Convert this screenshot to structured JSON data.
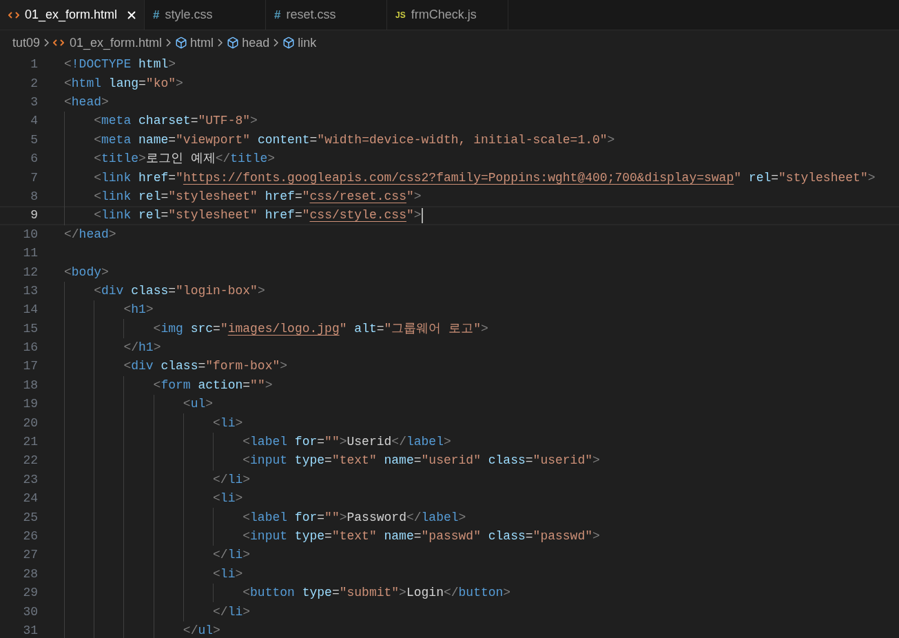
{
  "tabs": [
    {
      "label": "01_ex_form.html",
      "kind": "html",
      "selected": true
    },
    {
      "label": "style.css",
      "kind": "css",
      "glyph": "#",
      "selected": false
    },
    {
      "label": "reset.css",
      "kind": "css",
      "glyph": "#",
      "selected": false
    },
    {
      "label": "frmCheck.js",
      "kind": "js",
      "glyph": "JS",
      "selected": false
    }
  ],
  "breadcrumbs": [
    {
      "label": "tut09",
      "kind": "folder"
    },
    {
      "label": "01_ex_form.html",
      "kind": "file"
    },
    {
      "label": "html",
      "kind": "element"
    },
    {
      "label": "head",
      "kind": "element"
    },
    {
      "label": "link",
      "kind": "element"
    }
  ],
  "lines": [
    {
      "number": "1",
      "current": false,
      "tokens": [
        {
          "kind": "punct",
          "text": "<"
        },
        {
          "kind": "tag",
          "text": "!DOCTYPE"
        },
        {
          "kind": "attr",
          "text": " html"
        },
        {
          "kind": "punct",
          "text": ">"
        }
      ]
    },
    {
      "number": "2",
      "current": false,
      "tokens": [
        {
          "kind": "punct",
          "text": "<"
        },
        {
          "kind": "tag",
          "text": "html"
        },
        {
          "kind": "attr",
          "text": " lang"
        },
        {
          "kind": "op",
          "text": "="
        },
        {
          "kind": "string",
          "text": "\"ko\""
        },
        {
          "kind": "punct",
          "text": ">"
        }
      ]
    },
    {
      "number": "3",
      "current": false,
      "tokens": [
        {
          "kind": "punct",
          "text": "<"
        },
        {
          "kind": "tag",
          "text": "head"
        },
        {
          "kind": "punct",
          "text": ">"
        }
      ]
    },
    {
      "number": "4",
      "current": false,
      "tokens": [
        {
          "kind": "punct",
          "text": "    <"
        },
        {
          "kind": "tag",
          "text": "meta"
        },
        {
          "kind": "attr",
          "text": " charset"
        },
        {
          "kind": "op",
          "text": "="
        },
        {
          "kind": "string",
          "text": "\"UTF-8\""
        },
        {
          "kind": "punct",
          "text": ">"
        }
      ]
    },
    {
      "number": "5",
      "current": false,
      "tokens": [
        {
          "kind": "punct",
          "text": "    <"
        },
        {
          "kind": "tag",
          "text": "meta"
        },
        {
          "kind": "attr",
          "text": " name"
        },
        {
          "kind": "op",
          "text": "="
        },
        {
          "kind": "string",
          "text": "\"viewport\""
        },
        {
          "kind": "attr",
          "text": " content"
        },
        {
          "kind": "op",
          "text": "="
        },
        {
          "kind": "string",
          "text": "\"width=device-width, initial-scale=1.0\""
        },
        {
          "kind": "punct",
          "text": ">"
        }
      ]
    },
    {
      "number": "6",
      "current": false,
      "tokens": [
        {
          "kind": "punct",
          "text": "    <"
        },
        {
          "kind": "tag",
          "text": "title"
        },
        {
          "kind": "punct",
          "text": ">"
        },
        {
          "kind": "text",
          "text": "로그인 예제"
        },
        {
          "kind": "punct",
          "text": "</"
        },
        {
          "kind": "tag",
          "text": "title"
        },
        {
          "kind": "punct",
          "text": ">"
        }
      ]
    },
    {
      "number": "7",
      "current": false,
      "tokens": [
        {
          "kind": "punct",
          "text": "    <"
        },
        {
          "kind": "tag",
          "text": "link"
        },
        {
          "kind": "attr",
          "text": " href"
        },
        {
          "kind": "op",
          "text": "="
        },
        {
          "kind": "string",
          "text": "\""
        },
        {
          "kind": "link",
          "text": "https://fonts.googleapis.com/css2?family=Poppins:wght@400;700&display=swap"
        },
        {
          "kind": "string",
          "text": "\""
        },
        {
          "kind": "attr",
          "text": " rel"
        },
        {
          "kind": "op",
          "text": "="
        },
        {
          "kind": "string",
          "text": "\"stylesheet\""
        },
        {
          "kind": "punct",
          "text": ">"
        }
      ]
    },
    {
      "number": "8",
      "current": false,
      "tokens": [
        {
          "kind": "punct",
          "text": "    <"
        },
        {
          "kind": "tag",
          "text": "link"
        },
        {
          "kind": "attr",
          "text": " rel"
        },
        {
          "kind": "op",
          "text": "="
        },
        {
          "kind": "string",
          "text": "\"stylesheet\""
        },
        {
          "kind": "attr",
          "text": " href"
        },
        {
          "kind": "op",
          "text": "="
        },
        {
          "kind": "string",
          "text": "\""
        },
        {
          "kind": "link",
          "text": "css/reset.css"
        },
        {
          "kind": "string",
          "text": "\""
        },
        {
          "kind": "punct",
          "text": ">"
        }
      ]
    },
    {
      "number": "9",
      "current": true,
      "tokens": [
        {
          "kind": "punct",
          "text": "    <"
        },
        {
          "kind": "tag",
          "text": "link"
        },
        {
          "kind": "attr",
          "text": " rel"
        },
        {
          "kind": "op",
          "text": "="
        },
        {
          "kind": "string",
          "text": "\"stylesheet\""
        },
        {
          "kind": "attr",
          "text": " href"
        },
        {
          "kind": "op",
          "text": "="
        },
        {
          "kind": "string",
          "text": "\""
        },
        {
          "kind": "link",
          "text": "css/style.css"
        },
        {
          "kind": "string",
          "text": "\""
        },
        {
          "kind": "punct",
          "text": ">"
        }
      ]
    },
    {
      "number": "10",
      "current": false,
      "tokens": [
        {
          "kind": "punct",
          "text": "</"
        },
        {
          "kind": "tag",
          "text": "head"
        },
        {
          "kind": "punct",
          "text": ">"
        }
      ]
    },
    {
      "number": "11",
      "current": false
    },
    {
      "number": "12",
      "current": false,
      "tokens": [
        {
          "kind": "punct",
          "text": "<"
        },
        {
          "kind": "tag",
          "text": "body"
        },
        {
          "kind": "punct",
          "text": ">"
        }
      ]
    },
    {
      "number": "13",
      "current": false,
      "tokens": [
        {
          "kind": "punct",
          "text": "    <"
        },
        {
          "kind": "tag",
          "text": "div"
        },
        {
          "kind": "attr",
          "text": " class"
        },
        {
          "kind": "op",
          "text": "="
        },
        {
          "kind": "string",
          "text": "\"login-box\""
        },
        {
          "kind": "punct",
          "text": ">"
        }
      ]
    },
    {
      "number": "14",
      "current": false,
      "tokens": [
        {
          "kind": "punct",
          "text": "        <"
        },
        {
          "kind": "tag",
          "text": "h1"
        },
        {
          "kind": "punct",
          "text": ">"
        }
      ]
    },
    {
      "number": "15",
      "current": false,
      "tokens": [
        {
          "kind": "punct",
          "text": "            <"
        },
        {
          "kind": "tag",
          "text": "img"
        },
        {
          "kind": "attr",
          "text": " src"
        },
        {
          "kind": "op",
          "text": "="
        },
        {
          "kind": "string",
          "text": "\""
        },
        {
          "kind": "link",
          "text": "images/logo.jpg"
        },
        {
          "kind": "string",
          "text": "\""
        },
        {
          "kind": "attr",
          "text": " alt"
        },
        {
          "kind": "op",
          "text": "="
        },
        {
          "kind": "string",
          "text": "\"그룹웨어 로고\""
        },
        {
          "kind": "punct",
          "text": ">"
        }
      ]
    },
    {
      "number": "16",
      "current": false,
      "tokens": [
        {
          "kind": "punct",
          "text": "        </"
        },
        {
          "kind": "tag",
          "text": "h1"
        },
        {
          "kind": "punct",
          "text": ">"
        }
      ]
    },
    {
      "number": "17",
      "current": false,
      "tokens": [
        {
          "kind": "punct",
          "text": "        <"
        },
        {
          "kind": "tag",
          "text": "div"
        },
        {
          "kind": "attr",
          "text": " class"
        },
        {
          "kind": "op",
          "text": "="
        },
        {
          "kind": "string",
          "text": "\"form-box\""
        },
        {
          "kind": "punct",
          "text": ">"
        }
      ]
    },
    {
      "number": "18",
      "current": false,
      "tokens": [
        {
          "kind": "punct",
          "text": "            <"
        },
        {
          "kind": "tag",
          "text": "form"
        },
        {
          "kind": "attr",
          "text": " action"
        },
        {
          "kind": "op",
          "text": "="
        },
        {
          "kind": "string",
          "text": "\"\""
        },
        {
          "kind": "punct",
          "text": ">"
        }
      ]
    },
    {
      "number": "19",
      "current": false,
      "tokens": [
        {
          "kind": "punct",
          "text": "                <"
        },
        {
          "kind": "tag",
          "text": "ul"
        },
        {
          "kind": "punct",
          "text": ">"
        }
      ]
    },
    {
      "number": "20",
      "current": false,
      "tokens": [
        {
          "kind": "punct",
          "text": "                    <"
        },
        {
          "kind": "tag",
          "text": "li"
        },
        {
          "kind": "punct",
          "text": ">"
        }
      ]
    },
    {
      "number": "21",
      "current": false,
      "tokens": [
        {
          "kind": "punct",
          "text": "                        <"
        },
        {
          "kind": "tag",
          "text": "label"
        },
        {
          "kind": "attr",
          "text": " for"
        },
        {
          "kind": "op",
          "text": "="
        },
        {
          "kind": "string",
          "text": "\"\""
        },
        {
          "kind": "punct",
          "text": ">"
        },
        {
          "kind": "text",
          "text": "Userid"
        },
        {
          "kind": "punct",
          "text": "</"
        },
        {
          "kind": "tag",
          "text": "label"
        },
        {
          "kind": "punct",
          "text": ">"
        }
      ]
    },
    {
      "number": "22",
      "current": false,
      "tokens": [
        {
          "kind": "punct",
          "text": "                        <"
        },
        {
          "kind": "tag",
          "text": "input"
        },
        {
          "kind": "attr",
          "text": " type"
        },
        {
          "kind": "op",
          "text": "="
        },
        {
          "kind": "string",
          "text": "\"text\""
        },
        {
          "kind": "attr",
          "text": " name"
        },
        {
          "kind": "op",
          "text": "="
        },
        {
          "kind": "string",
          "text": "\"userid\""
        },
        {
          "kind": "attr",
          "text": " class"
        },
        {
          "kind": "op",
          "text": "="
        },
        {
          "kind": "string",
          "text": "\"userid\""
        },
        {
          "kind": "punct",
          "text": ">"
        }
      ]
    },
    {
      "number": "23",
      "current": false,
      "tokens": [
        {
          "kind": "punct",
          "text": "                    </"
        },
        {
          "kind": "tag",
          "text": "li"
        },
        {
          "kind": "punct",
          "text": ">"
        }
      ]
    },
    {
      "number": "24",
      "current": false,
      "tokens": [
        {
          "kind": "punct",
          "text": "                    <"
        },
        {
          "kind": "tag",
          "text": "li"
        },
        {
          "kind": "punct",
          "text": ">"
        }
      ]
    },
    {
      "number": "25",
      "current": false,
      "tokens": [
        {
          "kind": "punct",
          "text": "                        <"
        },
        {
          "kind": "tag",
          "text": "label"
        },
        {
          "kind": "attr",
          "text": " for"
        },
        {
          "kind": "op",
          "text": "="
        },
        {
          "kind": "string",
          "text": "\"\""
        },
        {
          "kind": "punct",
          "text": ">"
        },
        {
          "kind": "text",
          "text": "Password"
        },
        {
          "kind": "punct",
          "text": "</"
        },
        {
          "kind": "tag",
          "text": "label"
        },
        {
          "kind": "punct",
          "text": ">"
        }
      ]
    },
    {
      "number": "26",
      "current": false,
      "tokens": [
        {
          "kind": "punct",
          "text": "                        <"
        },
        {
          "kind": "tag",
          "text": "input"
        },
        {
          "kind": "attr",
          "text": " type"
        },
        {
          "kind": "op",
          "text": "="
        },
        {
          "kind": "string",
          "text": "\"text\""
        },
        {
          "kind": "attr",
          "text": " name"
        },
        {
          "kind": "op",
          "text": "="
        },
        {
          "kind": "string",
          "text": "\"passwd\""
        },
        {
          "kind": "attr",
          "text": " class"
        },
        {
          "kind": "op",
          "text": "="
        },
        {
          "kind": "string",
          "text": "\"passwd\""
        },
        {
          "kind": "punct",
          "text": ">"
        }
      ]
    },
    {
      "number": "27",
      "current": false,
      "tokens": [
        {
          "kind": "punct",
          "text": "                    </"
        },
        {
          "kind": "tag",
          "text": "li"
        },
        {
          "kind": "punct",
          "text": ">"
        }
      ]
    },
    {
      "number": "28",
      "current": false,
      "tokens": [
        {
          "kind": "punct",
          "text": "                    <"
        },
        {
          "kind": "tag",
          "text": "li"
        },
        {
          "kind": "punct",
          "text": ">"
        }
      ]
    },
    {
      "number": "29",
      "current": false,
      "tokens": [
        {
          "kind": "punct",
          "text": "                        <"
        },
        {
          "kind": "tag",
          "text": "button"
        },
        {
          "kind": "attr",
          "text": " type"
        },
        {
          "kind": "op",
          "text": "="
        },
        {
          "kind": "string",
          "text": "\"submit\""
        },
        {
          "kind": "punct",
          "text": ">"
        },
        {
          "kind": "text",
          "text": "Login"
        },
        {
          "kind": "punct",
          "text": "</"
        },
        {
          "kind": "tag",
          "text": "button"
        },
        {
          "kind": "punct",
          "text": ">"
        }
      ]
    },
    {
      "number": "30",
      "current": false,
      "tokens": [
        {
          "kind": "punct",
          "text": "                    </"
        },
        {
          "kind": "tag",
          "text": "li"
        },
        {
          "kind": "punct",
          "text": ">"
        }
      ]
    },
    {
      "number": "31",
      "current": false,
      "tokens": [
        {
          "kind": "punct",
          "text": "                </"
        },
        {
          "kind": "tag",
          "text": "ul"
        },
        {
          "kind": "punct",
          "text": ">"
        }
      ]
    }
  ]
}
